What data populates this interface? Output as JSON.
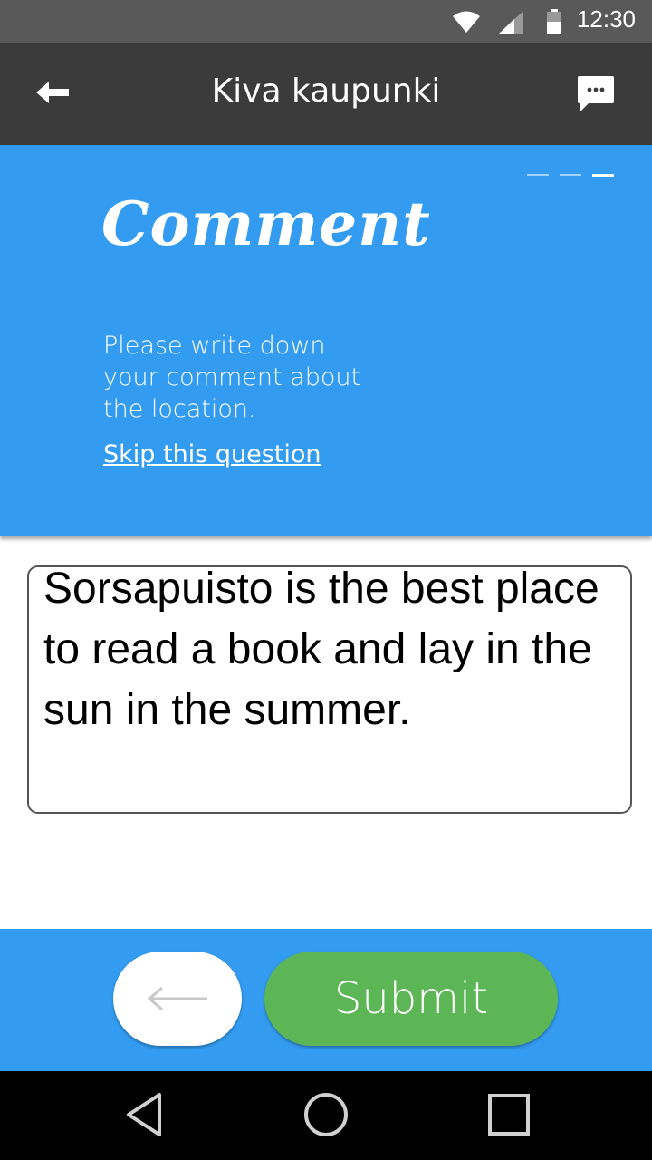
{
  "status_bar": {
    "time": "12:30",
    "icons": [
      "wifi-icon",
      "signal-icon",
      "battery-icon"
    ]
  },
  "app_bar": {
    "title": "Kiva kaupunki",
    "back_icon": "arrow-left-icon",
    "chat_icon": "chat-bubble-icon"
  },
  "question": {
    "title": "Comment",
    "description": "Please write down your comment about the location.",
    "skip_label": "Skip this question",
    "progress": {
      "current": 3,
      "total": 3
    }
  },
  "answer": {
    "value": "Sorsapuisto is the best place to read a book and lay in the sun in the summer."
  },
  "footer": {
    "prev_icon": "arrow-left-icon",
    "submit_label": "Submit"
  },
  "nav_bar": {
    "icons": [
      "back-triangle-icon",
      "home-circle-icon",
      "recents-square-icon"
    ]
  },
  "colors": {
    "status_bar": "#595959",
    "app_bar": "#3b3b3b",
    "accent_blue": "#339cf1",
    "submit_green": "#5cb655"
  }
}
